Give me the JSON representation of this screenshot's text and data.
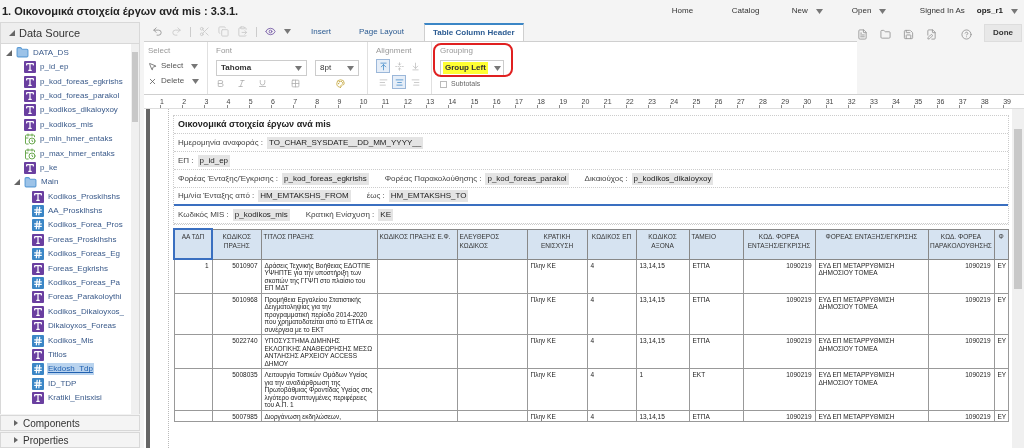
{
  "header": {
    "title": "1. Οικονομικά στοιχεία έργων ανά mis : 3.3.1.",
    "nav": [
      {
        "label": "Home",
        "dropdown": false
      },
      {
        "label": "Catalog",
        "dropdown": false
      },
      {
        "label": "New",
        "dropdown": true
      },
      {
        "label": "Open",
        "dropdown": true
      }
    ],
    "signed_in_label": "Signed In As",
    "user": "ops_r1",
    "done": "Done"
  },
  "sidebar": {
    "title": "Data Source",
    "tree": [
      {
        "label": "DATA_DS",
        "kind": "folder",
        "expanded": true,
        "selected": false,
        "children": [
          {
            "label": "p_id_ep",
            "kind": "text",
            "selected": false
          },
          {
            "label": "p_kod_foreas_egkrishs",
            "kind": "text",
            "selected": false
          },
          {
            "label": "p_kod_foreas_parakol",
            "kind": "text",
            "selected": false
          },
          {
            "label": "p_kodikos_dikaioyxoy",
            "kind": "text",
            "selected": false
          },
          {
            "label": "p_kodikos_mis",
            "kind": "text",
            "selected": false
          },
          {
            "label": "p_min_hmer_entaks",
            "kind": "date",
            "selected": false
          },
          {
            "label": "p_max_hmer_entaks",
            "kind": "date",
            "selected": false
          },
          {
            "label": "p_ke",
            "kind": "text",
            "selected": false
          },
          {
            "label": "Main",
            "kind": "folder",
            "expanded": true,
            "selected": false,
            "children": [
              {
                "label": "Kodikos_Proskihshs",
                "kind": "text",
                "selected": false
              },
              {
                "label": "AA_Prosklhshs",
                "kind": "number",
                "selected": false
              },
              {
                "label": "Kodikos_Forea_Pros",
                "kind": "number",
                "selected": false
              },
              {
                "label": "Foreas_Prosklhshs",
                "kind": "text",
                "selected": false
              },
              {
                "label": "Kodikos_Foreas_Eg",
                "kind": "number",
                "selected": false
              },
              {
                "label": "Foreas_Egkrishs",
                "kind": "text",
                "selected": false
              },
              {
                "label": "Kodikos_Foreas_Pa",
                "kind": "number",
                "selected": false
              },
              {
                "label": "Foreas_Parakoloythi",
                "kind": "text",
                "selected": false
              },
              {
                "label": "Kodikos_Dikaioyxos_",
                "kind": "text",
                "selected": false
              },
              {
                "label": "Dikaioyxos_Foreas",
                "kind": "text",
                "selected": false
              },
              {
                "label": "Kodikos_Mis",
                "kind": "number",
                "selected": false
              },
              {
                "label": "Titlos",
                "kind": "text",
                "selected": false
              },
              {
                "label": "Ekdosh_Tdp",
                "kind": "number",
                "selected": true
              },
              {
                "label": "ID_TDP",
                "kind": "number",
                "selected": false
              },
              {
                "label": "Kratiki_Enisxisi",
                "kind": "text",
                "selected": false
              }
            ]
          }
        ]
      }
    ],
    "panels": [
      {
        "label": "Components",
        "expanded": false
      },
      {
        "label": "Properties",
        "expanded": false
      }
    ]
  },
  "toolbar": {
    "tabs": [
      {
        "label": "Insert",
        "selected": false
      },
      {
        "label": "Page Layout",
        "selected": false
      },
      {
        "label": "Table Column Header",
        "selected": true
      }
    ],
    "select_group": {
      "title": "Select",
      "select": "Select",
      "delete": "Delete"
    },
    "font_group": {
      "title": "Font",
      "family": "Tahoma",
      "size": "8pt"
    },
    "alignment_group": {
      "title": "Alignment",
      "vertical": [
        {
          "selected": true
        },
        {
          "selected": false
        },
        {
          "selected": false
        }
      ],
      "horizontal": [
        {
          "selected": false
        },
        {
          "selected": true
        },
        {
          "selected": false
        }
      ]
    },
    "grouping_group": {
      "title": "Grouping",
      "value": "Group Left",
      "subtotals": {
        "label": "Subtotals",
        "checked": false
      }
    }
  },
  "ruler": [
    "1",
    "2",
    "3",
    "4",
    "5",
    "6",
    "7",
    "8",
    "9",
    "10",
    "11",
    "12",
    "13",
    "14",
    "15",
    "16",
    "17",
    "18",
    "19",
    "20",
    "21",
    "22",
    "23",
    "24",
    "25",
    "26",
    "27",
    "28",
    "29",
    "30",
    "31",
    "32",
    "33",
    "34",
    "35",
    "36",
    "37",
    "38",
    "39"
  ],
  "report": {
    "title": "Οικονομικά στοιχεία έργων ανά mis",
    "lines": [
      [
        {
          "label": "Ημερομηνία αναφοράς :",
          "value": "TO_CHAR_SYSDATE__DD_MM_YYYY__"
        }
      ],
      [
        {
          "label": "ΕΠ :",
          "value": "p_id_ep"
        }
      ],
      [
        {
          "label": "Φορέας Ένταξης/Έγκρισης :",
          "value": "p_kod_foreas_egkrishs"
        },
        {
          "label": "Φορέας Παρακολούθησης :",
          "value": "p_kod_foreas_parakol"
        },
        {
          "label": "Δικαιούχος :",
          "value": "p_kodikos_dikaioyxoy"
        }
      ],
      [
        {
          "label": "Ημ/νία Ένταξης από :",
          "value": "HM_EMTAKSHS_FROM"
        },
        {
          "label": "έως :",
          "value": "HM_EMTAKSHS_TO"
        }
      ],
      [
        {
          "label": "Κωδικός MIS :",
          "value": "p_kodikos_mis"
        },
        {
          "label": "Κρατική Ενίσχυση :",
          "value": "KE"
        }
      ]
    ],
    "table": {
      "columns": [
        {
          "label": "ΑΑ ΤΔΠ",
          "selected": true
        },
        {
          "label": "ΚΩΔΙΚΟΣ ΠΡΑΞΗΣ",
          "selected": false
        },
        {
          "label": "ΤΙΤΛΟΣ ΠΡΑΞΗΣ",
          "selected": false
        },
        {
          "label": "ΚΩΔΙΚΟΣ ΠΡΑΞΗΣ Ε.Φ.",
          "selected": false
        },
        {
          "label": "ΕΛΕΥΘΕΡΟΣ ΚΩΔΙΚΟΣ",
          "selected": false
        },
        {
          "label": "ΚΡΑΤΙΚΗ ΕΝΙΣΧΥΣΗ",
          "selected": false
        },
        {
          "label": "ΚΩΔΙΚΟΣ ΕΠ",
          "selected": false
        },
        {
          "label": "ΚΩΔΙΚΟΣ ΑΞΟΝΑ",
          "selected": false
        },
        {
          "label": "ΤΑΜΕΙΟ",
          "selected": false
        },
        {
          "label": "ΚΩΔ. ΦΟΡΕΑ ΕΝΤΑΞΗΣ/ΕΓΚΡΙΣΗΣ",
          "selected": false
        },
        {
          "label": "ΦΟΡΕΑΣ ΕΝΤΑΞΗΣ/ΕΓΚΡΙΣΗΣ",
          "selected": false
        },
        {
          "label": "ΚΩΔ. ΦΟΡΕΑ ΠΑΡΑΚΟΛΟΥΘΗΣΗΣ",
          "selected": false
        },
        {
          "label": "Φ",
          "selected": false
        }
      ],
      "rows": [
        {
          "aa": "1",
          "code": "5010907",
          "title": "Δράσεις Τεχνικής Βοήθειας ΕΔΟΤΠΕ ΥΨΗΠΤΕ για την υποστήριξη των σκοπών της ΓΓΨΠ στο πλαίσιο του ΕΠ ΜΔΤ",
          "state_aid": "Πλην ΚΕ",
          "ep_code": "4",
          "axis_code": "13,14,15",
          "fund": "ΕΤΠΑ",
          "agency_code": "1090219",
          "agency": "ΕΥΔ ΕΠ ΜΕΤΑΡΡΥΘΜΙΣΗ ΔΗΜΟΣΙΟΥ ΤΟΜΕΑ",
          "monitor_code": "1090219",
          "column_13": "ΕΥ"
        },
        {
          "code": "5010968",
          "title": "Προμήθεια Εργαλείου Στατιστικής Δειγματοληψίας για την προγραμματική περίοδο 2014-2020 που χρηματοδοτείται από το ΕΤΠΑ σε συνέργεια με το ΕΚΤ",
          "state_aid": "Πλην ΚΕ",
          "ep_code": "4",
          "axis_code": "13,14,15",
          "fund": "ΕΤΠΑ",
          "agency_code": "1090219",
          "agency": "ΕΥΔ ΕΠ ΜΕΤΑΡΡΥΘΜΙΣΗ ΔΗΜΟΣΙΟΥ ΤΟΜΕΑ",
          "monitor_code": "1090219",
          "column_13": "ΕΥ"
        },
        {
          "code": "5022740",
          "title": "ΥΠΟΣΥΣΤΗΜΑ ΔΙΜΗΝΗΣ ΕΚΛΟΓΙΚΗΣ ΑΝΑΘΕΩΡΗΣΗΣ ΜΕΣΩ ΑΝΤΛΗΣΗΣ ΑΡΧΕΙΟΥ ACCESS ΔΗΜΟΥ",
          "state_aid": "Πλην ΚΕ",
          "ep_code": "4",
          "axis_code": "13,14,15",
          "fund": "ΕΤΠΑ",
          "agency_code": "1090219",
          "agency": "ΕΥΔ ΕΠ ΜΕΤΑΡΡΥΘΜΙΣΗ ΔΗΜΟΣΙΟΥ ΤΟΜΕΑ",
          "monitor_code": "1090219",
          "column_13": "ΕΥ"
        },
        {
          "code": "5008035",
          "title": "Λειτουργία Τοπικών Ομάδων Υγείας για την αναδιάρθρωση της Πρωτοβάθμιας Φροντίδας Υγείας στις λιγότερο αναπτυγμένες περιφέρειες του Α.Π. 1",
          "state_aid": "Πλην ΚΕ",
          "ep_code": "4",
          "axis_code": "1",
          "fund": "ΕΚΤ",
          "agency_code": "1090219",
          "agency": "ΕΥΔ ΕΠ ΜΕΤΑΡΡΥΘΜΙΣΗ ΔΗΜΟΣΙΟΥ ΤΟΜΕΑ",
          "monitor_code": "1090219",
          "column_13": "ΕΥ"
        },
        {
          "code": "5007985",
          "title": "Διοργάνωση εκδηλώσεων,",
          "state_aid": "Πλην ΚΕ",
          "ep_code": "4",
          "axis_code": "13,14,15",
          "fund": "ΕΤΠΑ",
          "agency_code": "1090219",
          "agency": "ΕΥΔ ΕΠ ΜΕΤΑΡΡΥΘΜΙΣΗ",
          "monitor_code": "1090219",
          "column_13": "ΕΥ"
        }
      ]
    }
  }
}
